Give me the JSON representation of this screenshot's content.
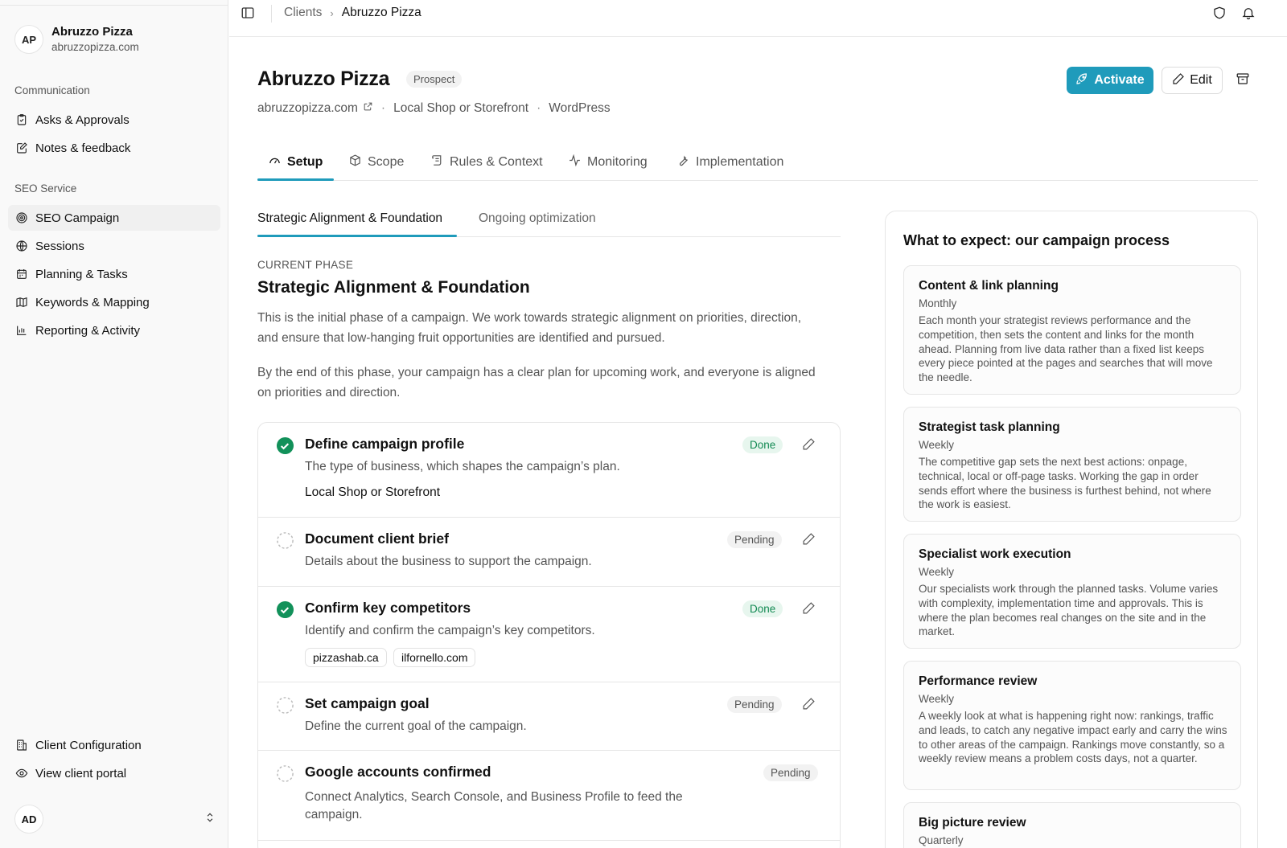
{
  "sidebar": {
    "client_initials": "AP",
    "client_name": "Abruzzo Pizza",
    "client_domain": "abruzzopizza.com",
    "groups": {
      "communication": "Communication",
      "seo_service": "SEO Service"
    },
    "items": [
      {
        "label": "Asks & Approvals",
        "icon": "clipboard-check-icon"
      },
      {
        "label": "Notes & feedback",
        "icon": "note-edit-icon"
      },
      {
        "label": "SEO Campaign",
        "icon": "target-icon"
      },
      {
        "label": "Sessions",
        "icon": "globe-icon"
      },
      {
        "label": "Planning & Tasks",
        "icon": "calendar-icon"
      },
      {
        "label": "Keywords & Mapping",
        "icon": "map-icon"
      },
      {
        "label": "Reporting & Activity",
        "icon": "bar-chart-icon"
      },
      {
        "label": "Client Configuration",
        "icon": "building-icon"
      },
      {
        "label": "View client portal",
        "icon": "eye-icon"
      }
    ],
    "active_item": "SEO Campaign",
    "user_initials": "AD"
  },
  "breadcrumb": {
    "parent": "Clients",
    "current": "Abruzzo Pizza"
  },
  "header": {
    "title": "Abruzzo Pizza",
    "status": "Prospect",
    "domain": "abruzzopizza.com",
    "business_type": "Local Shop or Storefront",
    "platform": "WordPress",
    "activate_label": "Activate",
    "edit_label": "Edit"
  },
  "tabs": [
    {
      "label": "Setup",
      "active": true
    },
    {
      "label": "Scope",
      "active": false
    },
    {
      "label": "Rules & Context",
      "active": false
    },
    {
      "label": "Monitoring",
      "active": false
    },
    {
      "label": "Implementation",
      "active": false
    }
  ],
  "subtabs": [
    {
      "label": "Strategic Alignment & Foundation",
      "active": true
    },
    {
      "label": "Ongoing optimization",
      "active": false
    }
  ],
  "phase": {
    "label": "CURRENT PHASE",
    "title": "Strategic Alignment & Foundation",
    "p1": "This is the initial phase of a campaign. We work towards strategic alignment on priorities, direction, and ensure that low-hanging fruit opportunities are identified and pursued.",
    "p2": "By the end of this phase, your campaign has a clear plan for upcoming work, and everyone is aligned on priorities and direction."
  },
  "steps": [
    {
      "title": "Define campaign profile",
      "status": "Done",
      "desc": "The type of business, which shapes the campaign’s plan.",
      "value": "Local Shop or Storefront"
    },
    {
      "title": "Document client brief",
      "status": "Pending",
      "desc": "Details about the business to support the campaign."
    },
    {
      "title": "Confirm key competitors",
      "status": "Done",
      "desc": "Identify and confirm the campaign’s key competitors.",
      "chips": [
        "pizzashab.ca",
        "ilfornello.com"
      ]
    },
    {
      "title": "Set campaign goal",
      "status": "Pending",
      "desc": "Define the current goal of the campaign."
    },
    {
      "title": "Google accounts confirmed",
      "status": "Pending",
      "desc": "Connect Analytics, Search Console, and Business Profile to feed the campaign."
    }
  ],
  "process": {
    "title": "What to expect: our campaign process",
    "cards": [
      {
        "title": "Content & link planning",
        "freq": "Monthly",
        "body": "Each month your strategist reviews performance and the competition, then sets the content and links for the month ahead. Planning from live data rather than a fixed list keeps every piece pointed at the pages and searches that will move the needle."
      },
      {
        "title": "Strategist task planning",
        "freq": "Weekly",
        "body": "The competitive gap sets the next best actions: onpage, technical, local or off-page tasks. Working the gap in order sends effort where the business is furthest behind, not where the work is easiest."
      },
      {
        "title": "Specialist work execution",
        "freq": "Weekly",
        "body": "Our specialists work through the planned tasks. Volume varies with complexity, implementation time and approvals. This is where the plan becomes real changes on the site and in the market."
      },
      {
        "title": "Performance review",
        "freq": "Weekly",
        "body": "A weekly look at what is happening right now: rankings, traffic and leads, to catch any negative impact early and carry the wins to other areas of the campaign. Rankings move constantly, so a weekly review means a problem costs days, not a quarter."
      },
      {
        "title": "Big picture review",
        "freq": "Quarterly",
        "body": ""
      }
    ]
  },
  "colors": {
    "accent": "#1f9bbb",
    "done_text": "#138a53",
    "done_bg": "#e7f6ee",
    "check_green": "#12915a"
  }
}
